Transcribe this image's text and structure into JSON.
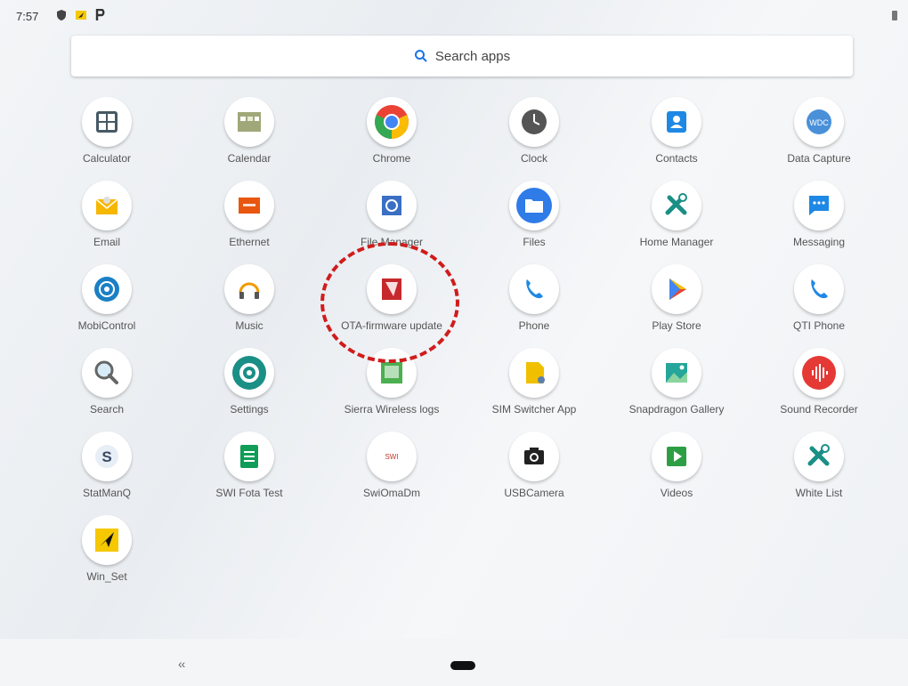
{
  "status_bar": {
    "time": "7:57",
    "icons": [
      "shield-icon",
      "notification-icon",
      "parking-icon"
    ]
  },
  "search": {
    "label": "Search apps"
  },
  "apps": [
    {
      "label": "Calculator",
      "icon": "calculator-icon",
      "color": "#455a64"
    },
    {
      "label": "Calendar",
      "icon": "calendar-icon",
      "color": "#a0a87a"
    },
    {
      "label": "Chrome",
      "icon": "chrome-icon",
      "color": "#4285f4"
    },
    {
      "label": "Clock",
      "icon": "clock-icon",
      "color": "#555555"
    },
    {
      "label": "Contacts",
      "icon": "contacts-icon",
      "color": "#1e88e5"
    },
    {
      "label": "Data Capture",
      "icon": "data-capture-icon",
      "color": "#4a90d9"
    },
    {
      "label": "Email",
      "icon": "email-icon",
      "color": "#f5b700"
    },
    {
      "label": "Ethernet",
      "icon": "ethernet-icon",
      "color": "#e8560f"
    },
    {
      "label": "File Manager",
      "icon": "file-manager-icon",
      "color": "#3a6fc4"
    },
    {
      "label": "Files",
      "icon": "files-icon",
      "color": "#2f7be8"
    },
    {
      "label": "Home Manager",
      "icon": "home-manager-icon",
      "color": "#1a8f86"
    },
    {
      "label": "Messaging",
      "icon": "messaging-icon",
      "color": "#1e88e5"
    },
    {
      "label": "MobiControl",
      "icon": "mobicontrol-icon",
      "color": "#1a7fc4"
    },
    {
      "label": "Music",
      "icon": "music-icon",
      "color": "#f29900"
    },
    {
      "label": "OTA-firmware update",
      "icon": "ota-update-icon",
      "color": "#c7282d"
    },
    {
      "label": "Phone",
      "icon": "phone-icon",
      "color": "#1e88e5"
    },
    {
      "label": "Play Store",
      "icon": "play-store-icon",
      "color": "#34a853"
    },
    {
      "label": "QTI Phone",
      "icon": "qti-phone-icon",
      "color": "#1e88e5"
    },
    {
      "label": "Search",
      "icon": "search-magnifier-icon",
      "color": "#666666"
    },
    {
      "label": "Settings",
      "icon": "settings-icon",
      "color": "#1a8f86"
    },
    {
      "label": "Sierra Wireless logs",
      "icon": "sierra-logs-icon",
      "color": "#4caf50"
    },
    {
      "label": "SIM Switcher App",
      "icon": "sim-switcher-icon",
      "color": "#f0c000"
    },
    {
      "label": "Snapdragon Gallery",
      "icon": "gallery-icon",
      "color": "#26a69a"
    },
    {
      "label": "Sound Recorder",
      "icon": "sound-recorder-icon",
      "color": "#e53935"
    },
    {
      "label": "StatManQ",
      "icon": "statmanq-icon",
      "color": "#3a4a66"
    },
    {
      "label": "SWI Fota Test",
      "icon": "sheets-icon",
      "color": "#0f9d58"
    },
    {
      "label": "SwiOmaDm",
      "icon": "swiomadm-icon",
      "color": "#c0392b"
    },
    {
      "label": "USBCamera",
      "icon": "camera-icon",
      "color": "#222222"
    },
    {
      "label": "Videos",
      "icon": "videos-icon",
      "color": "#2e9e44"
    },
    {
      "label": "White List",
      "icon": "white-list-icon",
      "color": "#1a8f86"
    },
    {
      "label": "Win_Set",
      "icon": "win-set-icon",
      "color": "#f5c800"
    }
  ],
  "nav": {
    "back_label": "‹‹"
  }
}
